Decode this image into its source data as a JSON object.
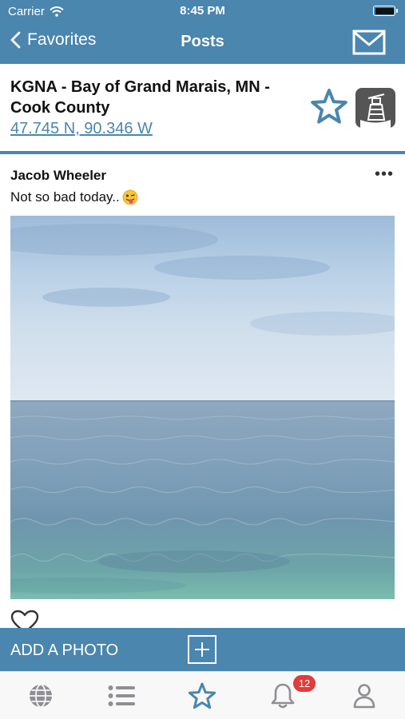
{
  "status_bar": {
    "carrier": "Carrier",
    "time": "8:45 PM"
  },
  "nav": {
    "back_label": "Favorites",
    "title": "Posts"
  },
  "station": {
    "name": "KGNA - Bay of Grand Marais, MN - Cook County",
    "coords": "47.745 N, 90.346 W"
  },
  "post": {
    "author": "Jacob Wheeler",
    "caption": "Not so bad today..",
    "more": "•••"
  },
  "actions": {
    "add_photo_label": "ADD A PHOTO"
  },
  "tab_bar": {
    "notifications_badge": "12"
  },
  "colors": {
    "primary": "#4a86ae",
    "badge": "#e23b3b",
    "tab_icon": "#8e8e93"
  }
}
